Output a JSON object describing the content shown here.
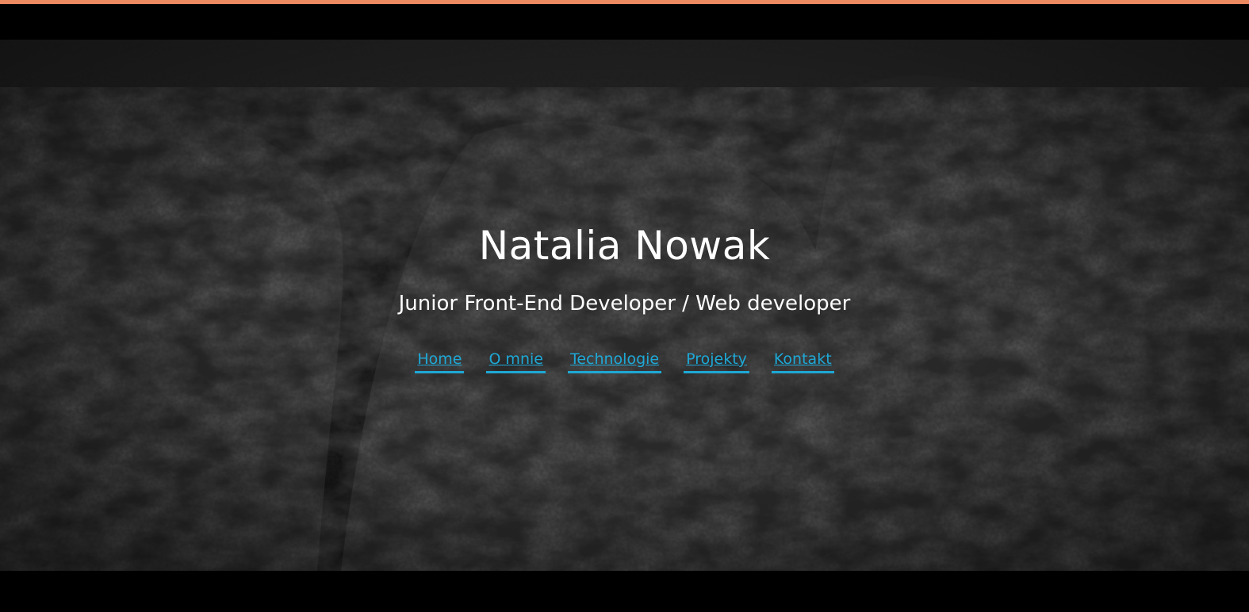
{
  "hero": {
    "name": "Natalia Nowak",
    "subtitle": "Junior Front-End Developer / Web developer"
  },
  "nav": {
    "items": [
      {
        "label": "Home"
      },
      {
        "label": "O mnie"
      },
      {
        "label": "Technologie"
      },
      {
        "label": "Projekty"
      },
      {
        "label": "Kontakt"
      }
    ]
  },
  "colors": {
    "accent_bar": "#ee8a62",
    "link": "#1ea8d6",
    "text": "#ffffff",
    "background": "#000000"
  }
}
